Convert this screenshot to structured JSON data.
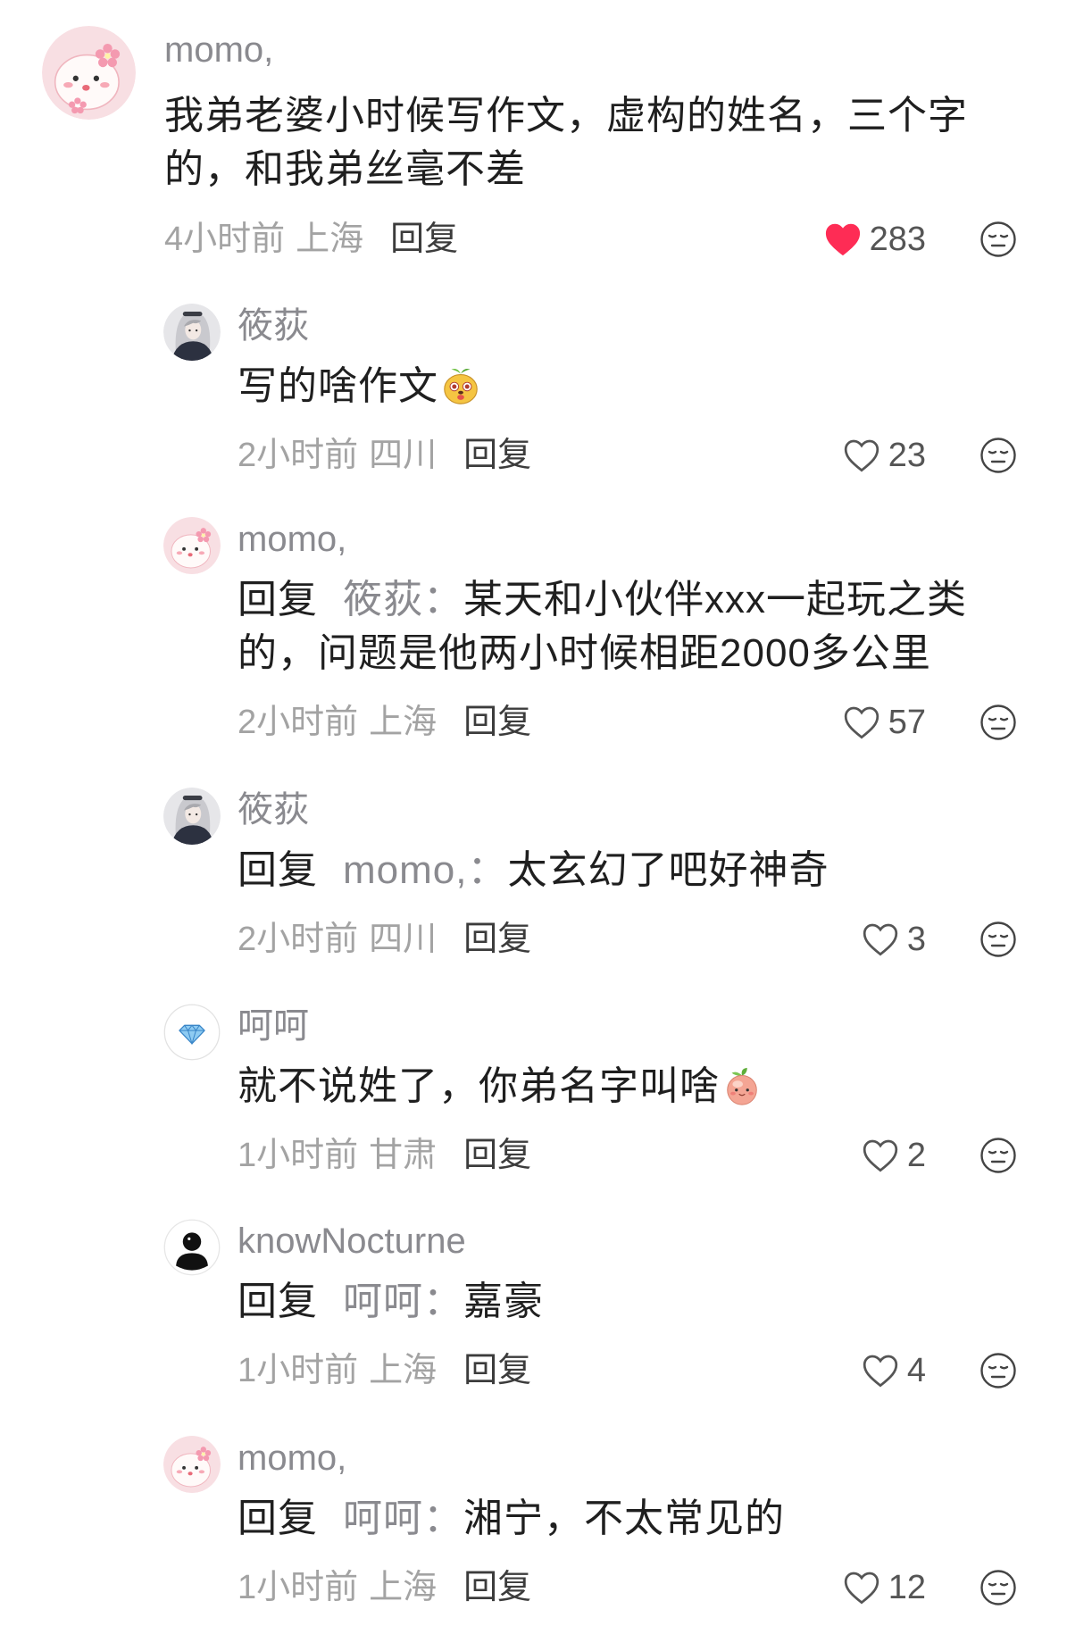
{
  "comments": [
    {
      "name": "momo,",
      "avatar": "pink-cartoon-avatar",
      "text": "我弟老婆小时候写作文，虚构的姓名，三个字的，和我弟丝毫不差",
      "time": "4小时前",
      "location": "上海",
      "reply_label": "回复",
      "likes": "283",
      "liked": true
    },
    {
      "name": "筱荻",
      "avatar": "anime-girl-avatar",
      "text": "写的啥作文",
      "emoji": "yellow-puppy-emoji",
      "time": "2小时前",
      "location": "四川",
      "reply_label": "回复",
      "likes": "23",
      "liked": false
    },
    {
      "name": "momo,",
      "avatar": "pink-cartoon-avatar",
      "reply_prefix": "回复",
      "reply_to": "筱荻：",
      "text": "某天和小伙伴xxx一起玩之类的，问题是他两小时候相距2000多公里",
      "time": "2小时前",
      "location": "上海",
      "reply_label": "回复",
      "likes": "57",
      "liked": false
    },
    {
      "name": "筱荻",
      "avatar": "anime-girl-avatar",
      "reply_prefix": "回复",
      "reply_to": "momo,：",
      "text": "太玄幻了吧好神奇",
      "time": "2小时前",
      "location": "四川",
      "reply_label": "回复",
      "likes": "3",
      "liked": false
    },
    {
      "name": "呵呵",
      "avatar": "diamond-avatar",
      "text": "就不说姓了，你弟名字叫啥",
      "emoji": "peach-emoji",
      "time": "1小时前",
      "location": "甘肃",
      "reply_label": "回复",
      "likes": "2",
      "liked": false
    },
    {
      "name": "knowNocturne",
      "avatar": "default-person-avatar",
      "reply_prefix": "回复",
      "reply_to": "呵呵：",
      "text": "嘉豪",
      "time": "1小时前",
      "location": "上海",
      "reply_label": "回复",
      "likes": "4",
      "liked": false
    },
    {
      "name": "momo,",
      "avatar": "pink-cartoon-avatar",
      "reply_prefix": "回复",
      "reply_to": "呵呵：",
      "text": "湘宁，不太常见的",
      "time": "1小时前",
      "location": "上海",
      "reply_label": "回复",
      "likes": "12",
      "liked": false
    }
  ],
  "icons": {
    "like_filled": "heart-filled-icon",
    "like_outline": "heart-outline-icon",
    "dislike": "meh-face-icon"
  },
  "colors": {
    "like_active": "#fe2c55",
    "author_name": "#8a8a8f",
    "body_text": "#1f1f1f",
    "meta_text": "#a3a3a3"
  }
}
